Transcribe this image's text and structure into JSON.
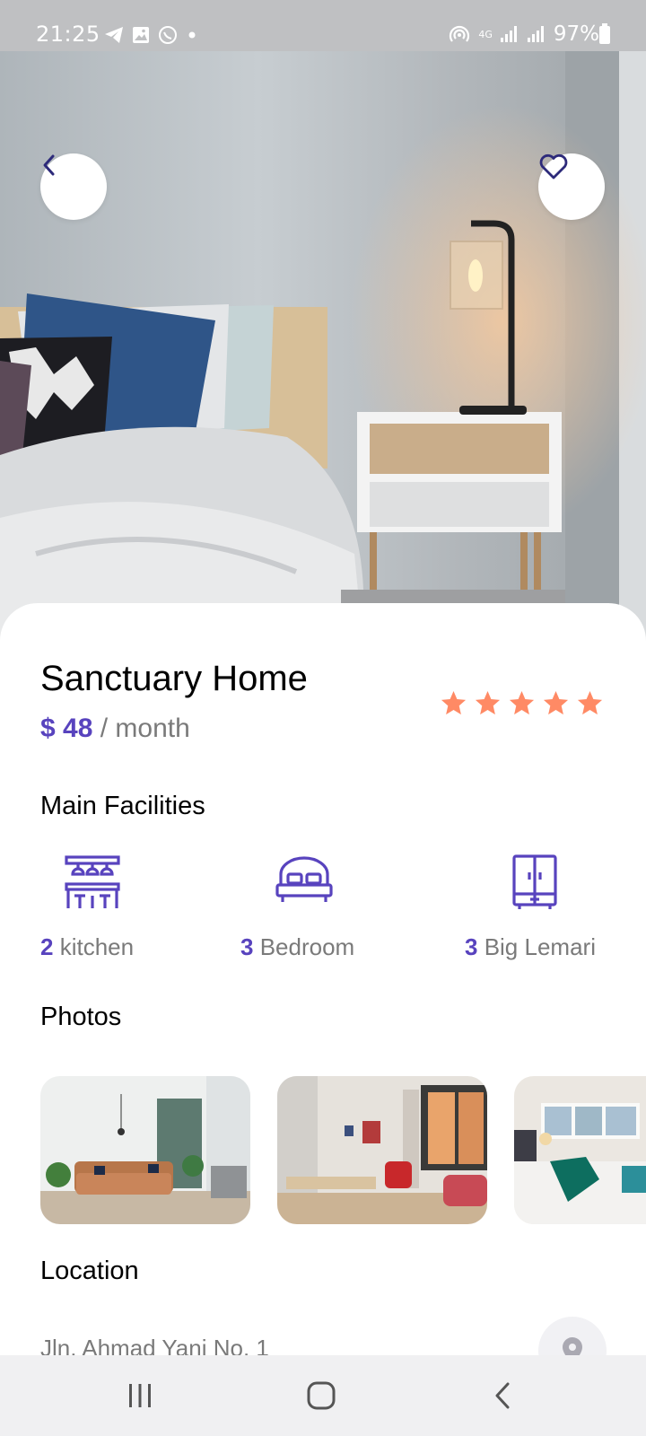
{
  "status_bar": {
    "time": "21:25",
    "network": "4G",
    "battery": "97%",
    "left_icons": [
      "telegram-icon",
      "gallery-icon",
      "whatsapp-icon",
      "dot-icon"
    ],
    "right_icons": [
      "hotspot-icon",
      "signal-icon",
      "signal-icon",
      "battery-icon"
    ]
  },
  "hero": {
    "back_icon": "chevron-left-icon",
    "favorite_icon": "heart-outline-icon"
  },
  "listing": {
    "title": "Sanctuary Home",
    "price": "$ 48",
    "period": " / month",
    "rating": 5,
    "rating_max": 5
  },
  "facilities": {
    "heading": "Main Facilities",
    "items": [
      {
        "count": "2",
        "label": " kitchen",
        "icon": "kitchen-icon"
      },
      {
        "count": "3",
        "label": " Bedroom",
        "icon": "bed-icon"
      },
      {
        "count": "3",
        "label": " Big Lemari",
        "icon": "wardrobe-icon"
      }
    ]
  },
  "photos": {
    "heading": "Photos",
    "items": [
      "living-room-photo",
      "dining-room-photo",
      "bedroom-photo"
    ]
  },
  "location": {
    "heading": "Location",
    "address": "Jln. Ahmad Yani No. 1",
    "map_icon": "map-pin-icon"
  },
  "colors": {
    "accent": "#5843be",
    "star": "#ff8a65",
    "muted_text": "#7a7a7a"
  }
}
